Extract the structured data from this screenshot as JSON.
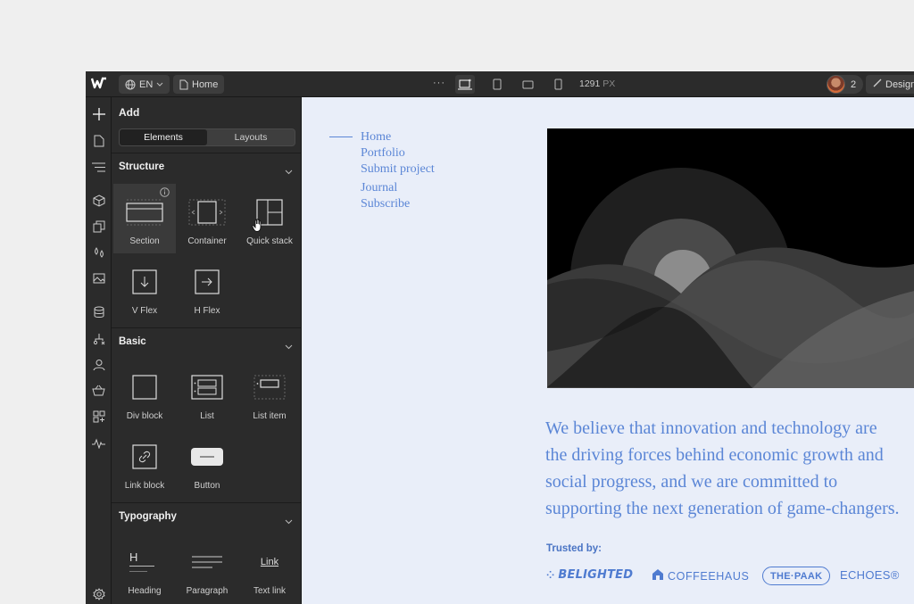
{
  "topbar": {
    "language": "EN",
    "page": "Home",
    "more": "···",
    "width_value": "1291",
    "width_unit": "PX",
    "collaborators_count": "2",
    "mode_label": "Design"
  },
  "panel": {
    "title": "Add",
    "tabs": [
      {
        "label": "Elements",
        "active": true
      },
      {
        "label": "Layouts",
        "active": false
      }
    ],
    "structure": {
      "heading": "Structure",
      "items": [
        {
          "label": "Section",
          "icon": "section-icon"
        },
        {
          "label": "Container",
          "icon": "container-icon"
        },
        {
          "label": "Quick stack",
          "icon": "quick-stack-icon"
        },
        {
          "label": "V Flex",
          "icon": "v-flex-icon"
        },
        {
          "label": "H Flex",
          "icon": "h-flex-icon"
        }
      ]
    },
    "basic": {
      "heading": "Basic",
      "items": [
        {
          "label": "Div block",
          "icon": "div-block-icon"
        },
        {
          "label": "List",
          "icon": "list-icon"
        },
        {
          "label": "List item",
          "icon": "list-item-icon"
        },
        {
          "label": "Link block",
          "icon": "link-block-icon"
        },
        {
          "label": "Button",
          "icon": "button-icon"
        }
      ]
    },
    "typography": {
      "heading": "Typography",
      "items": [
        {
          "label": "Heading",
          "icon": "heading-icon",
          "glyph": "H"
        },
        {
          "label": "Paragraph",
          "icon": "paragraph-icon"
        },
        {
          "label": "Text link",
          "icon": "text-link-icon",
          "glyph": "Link"
        }
      ]
    }
  },
  "canvas": {
    "nav": [
      "Home",
      "Portfolio",
      "Submit project",
      "Journal",
      "Subscribe"
    ],
    "statement": "We believe that innovation and technology are the driving forces behind economic growth and social progress, and we are committed to supporting the next generation of game-changers.",
    "trusted_label": "Trusted by:",
    "brands": [
      "BELIGHTED",
      "COFFEEHAUS",
      "THE·PAAK",
      "ECHOES®"
    ]
  },
  "colors": {
    "accent": "#5b86d6",
    "canvas_bg": "#e9eef9",
    "ui_dark": "#2b2b2b"
  }
}
